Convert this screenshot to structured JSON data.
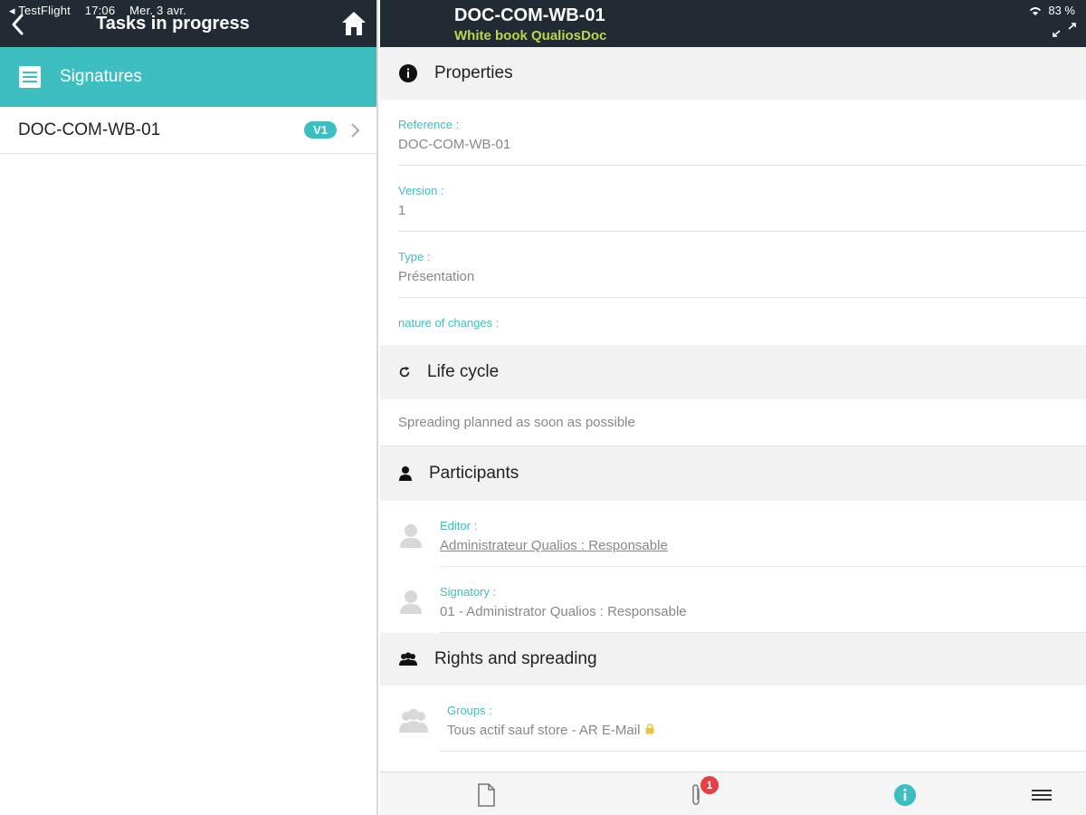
{
  "status_bar": {
    "app": "◂ TestFlight",
    "time": "17:06",
    "date": "Mer. 3 avr.",
    "battery": "83 %"
  },
  "left": {
    "title": "Tasks in progress",
    "section_label": "Signatures",
    "items": [
      {
        "name": "DOC-COM-WB-01",
        "version": "V1"
      }
    ]
  },
  "right": {
    "title": "DOC-COM-WB-01",
    "subtitle": "White book QualiosDoc",
    "properties": {
      "heading": "Properties",
      "reference_label": "Reference :",
      "reference_value": "DOC-COM-WB-01",
      "version_label": "Version :",
      "version_value": "1",
      "type_label": "Type :",
      "type_value": "Présentation",
      "nature_label": "nature of changes :"
    },
    "life_cycle": {
      "heading": "Life cycle",
      "text": "Spreading planned as soon as possible"
    },
    "participants": {
      "heading": "Participants",
      "editor_label": "Editor :",
      "editor_value": "Administrateur Qualios : Responsable",
      "signatory_label": "Signatory :",
      "signatory_value": "01 - Administrator Qualios : Responsable"
    },
    "rights": {
      "heading": "Rights and spreading",
      "groups_label": "Groups :",
      "groups_value": "Tous actif sauf store - AR E-Mail"
    },
    "toolbar": {
      "attachments_count": "1"
    }
  },
  "colors": {
    "accent": "#3dbfc1",
    "topbar": "#222b33",
    "subtitle": "#b8d84a",
    "notification": "#e84040"
  }
}
